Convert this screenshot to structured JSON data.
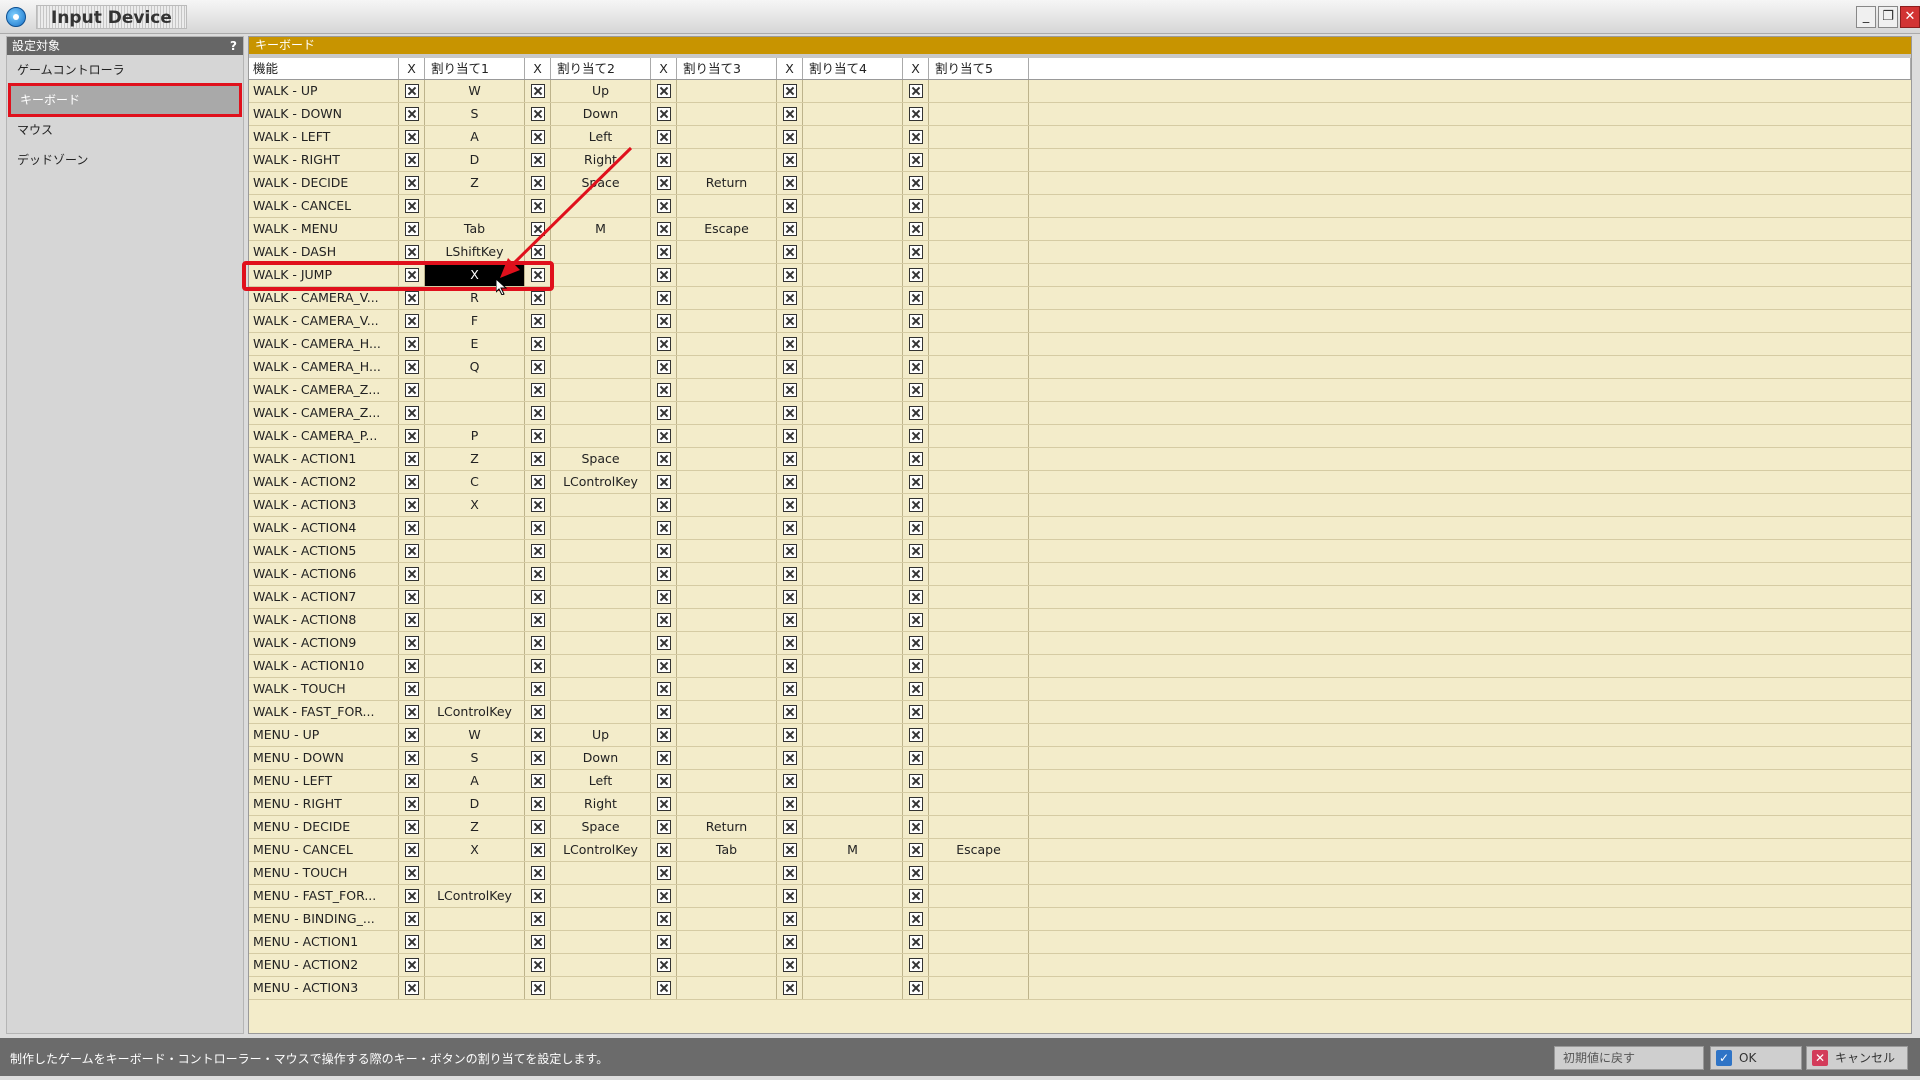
{
  "window": {
    "title": "Input Device",
    "min_label": "_",
    "max_label": "❐",
    "close_label": "✕"
  },
  "sidebar": {
    "header": "設定対象",
    "help": "?",
    "items": [
      {
        "label": "ゲームコントローラ",
        "selected": false
      },
      {
        "label": "キーボード",
        "selected": true
      },
      {
        "label": "マウス",
        "selected": false
      },
      {
        "label": "デッドゾーン",
        "selected": false
      }
    ]
  },
  "main": {
    "header": "キーボード",
    "columns": [
      "機能",
      "X",
      "割り当て1",
      "X",
      "割り当て2",
      "X",
      "割り当て3",
      "X",
      "割り当て4",
      "X",
      "割り当て5"
    ],
    "selected_row": 8,
    "selected_col": 0,
    "rows": [
      {
        "func": "WALK - UP",
        "a": [
          "W",
          "Up",
          "",
          "",
          ""
        ]
      },
      {
        "func": "WALK - DOWN",
        "a": [
          "S",
          "Down",
          "",
          "",
          ""
        ]
      },
      {
        "func": "WALK - LEFT",
        "a": [
          "A",
          "Left",
          "",
          "",
          ""
        ]
      },
      {
        "func": "WALK - RIGHT",
        "a": [
          "D",
          "Right",
          "",
          "",
          ""
        ]
      },
      {
        "func": "WALK - DECIDE",
        "a": [
          "Z",
          "Space",
          "Return",
          "",
          ""
        ]
      },
      {
        "func": "WALK - CANCEL",
        "a": [
          "",
          "",
          "",
          "",
          ""
        ]
      },
      {
        "func": "WALK - MENU",
        "a": [
          "Tab",
          "M",
          "Escape",
          "",
          ""
        ]
      },
      {
        "func": "WALK - DASH",
        "a": [
          "LShiftKey",
          "",
          "",
          "",
          ""
        ]
      },
      {
        "func": "WALK - JUMP",
        "a": [
          "X",
          "",
          "",
          "",
          ""
        ]
      },
      {
        "func": "WALK - CAMERA_V...",
        "a": [
          "R",
          "",
          "",
          "",
          ""
        ]
      },
      {
        "func": "WALK - CAMERA_V...",
        "a": [
          "F",
          "",
          "",
          "",
          ""
        ]
      },
      {
        "func": "WALK - CAMERA_H...",
        "a": [
          "E",
          "",
          "",
          "",
          ""
        ]
      },
      {
        "func": "WALK - CAMERA_H...",
        "a": [
          "Q",
          "",
          "",
          "",
          ""
        ]
      },
      {
        "func": "WALK - CAMERA_Z...",
        "a": [
          "",
          "",
          "",
          "",
          ""
        ]
      },
      {
        "func": "WALK - CAMERA_Z...",
        "a": [
          "",
          "",
          "",
          "",
          ""
        ]
      },
      {
        "func": "WALK - CAMERA_P...",
        "a": [
          "P",
          "",
          "",
          "",
          ""
        ]
      },
      {
        "func": "WALK - ACTION1",
        "a": [
          "Z",
          "Space",
          "",
          "",
          ""
        ]
      },
      {
        "func": "WALK - ACTION2",
        "a": [
          "C",
          "LControlKey",
          "",
          "",
          ""
        ]
      },
      {
        "func": "WALK - ACTION3",
        "a": [
          "X",
          "",
          "",
          "",
          ""
        ]
      },
      {
        "func": "WALK - ACTION4",
        "a": [
          "",
          "",
          "",
          "",
          ""
        ]
      },
      {
        "func": "WALK - ACTION5",
        "a": [
          "",
          "",
          "",
          "",
          ""
        ]
      },
      {
        "func": "WALK - ACTION6",
        "a": [
          "",
          "",
          "",
          "",
          ""
        ]
      },
      {
        "func": "WALK - ACTION7",
        "a": [
          "",
          "",
          "",
          "",
          ""
        ]
      },
      {
        "func": "WALK - ACTION8",
        "a": [
          "",
          "",
          "",
          "",
          ""
        ]
      },
      {
        "func": "WALK - ACTION9",
        "a": [
          "",
          "",
          "",
          "",
          ""
        ]
      },
      {
        "func": "WALK - ACTION10",
        "a": [
          "",
          "",
          "",
          "",
          ""
        ]
      },
      {
        "func": "WALK - TOUCH",
        "a": [
          "",
          "",
          "",
          "",
          ""
        ]
      },
      {
        "func": "WALK - FAST_FOR...",
        "a": [
          "LControlKey",
          "",
          "",
          "",
          ""
        ]
      },
      {
        "func": "MENU - UP",
        "a": [
          "W",
          "Up",
          "",
          "",
          ""
        ]
      },
      {
        "func": "MENU - DOWN",
        "a": [
          "S",
          "Down",
          "",
          "",
          ""
        ]
      },
      {
        "func": "MENU - LEFT",
        "a": [
          "A",
          "Left",
          "",
          "",
          ""
        ]
      },
      {
        "func": "MENU - RIGHT",
        "a": [
          "D",
          "Right",
          "",
          "",
          ""
        ]
      },
      {
        "func": "MENU - DECIDE",
        "a": [
          "Z",
          "Space",
          "Return",
          "",
          ""
        ]
      },
      {
        "func": "MENU - CANCEL",
        "a": [
          "X",
          "LControlKey",
          "Tab",
          "M",
          "Escape"
        ]
      },
      {
        "func": "MENU - TOUCH",
        "a": [
          "",
          "",
          "",
          "",
          ""
        ]
      },
      {
        "func": "MENU - FAST_FOR...",
        "a": [
          "LControlKey",
          "",
          "",
          "",
          ""
        ]
      },
      {
        "func": "MENU - BINDING_...",
        "a": [
          "",
          "",
          "",
          "",
          ""
        ]
      },
      {
        "func": "MENU - ACTION1",
        "a": [
          "",
          "",
          "",
          "",
          ""
        ]
      },
      {
        "func": "MENU - ACTION2",
        "a": [
          "",
          "",
          "",
          "",
          ""
        ]
      },
      {
        "func": "MENU - ACTION3",
        "a": [
          "",
          "",
          "",
          "",
          ""
        ]
      }
    ]
  },
  "footer": {
    "status": "制作したゲームをキーボード・コントローラー・マウスで操作する際のキー・ボタンの割り当てを設定します。",
    "reset_label": "初期値に戻す",
    "ok_label": "OK",
    "cancel_label": "キャンセル"
  },
  "colors": {
    "accent_header": "#c89400",
    "highlight": "#e0101c",
    "grid_bg": "#f3ecca"
  }
}
